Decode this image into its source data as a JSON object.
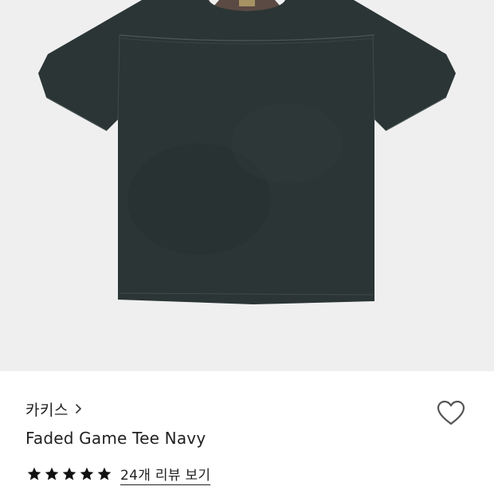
{
  "product": {
    "image_alt": "Faded Game Tee Navy product photo",
    "brand": "카키스",
    "name": "Faded Game Tee Navy",
    "rating": {
      "stars": 5,
      "max": 5
    },
    "review_link": "24개 리뷰 보기"
  },
  "icons": {
    "brand_chevron": "chevron-right-icon",
    "like": "heart-outline-icon",
    "star": "star-filled-icon"
  },
  "colors": {
    "image_background": "#efefef",
    "shirt": "#2b3535",
    "collar": "#5a4a43",
    "text": "#222222",
    "heart_stroke": "#555555"
  }
}
